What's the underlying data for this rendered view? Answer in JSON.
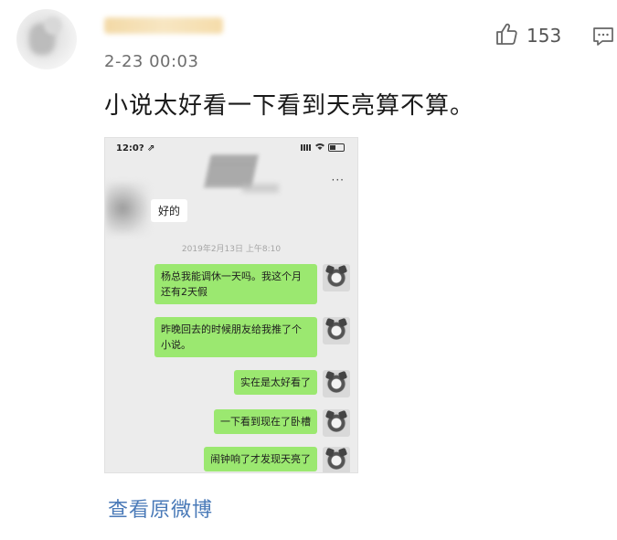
{
  "post": {
    "username": "",
    "timestamp": "2-23 00:03",
    "likes": "153",
    "text": "小说太好看一下看到天亮算不算。",
    "view_original": "查看原微博"
  },
  "screenshot": {
    "status_time": "12:0? ⇗",
    "more": "···",
    "received_message": "好的",
    "chat_time": "2019年2月13日 上午8:10",
    "sent_messages": [
      "杨总我能调休一天吗。我这个月还有2天假",
      "昨晚回去的时候朋友给我推了个小说。",
      "实在是太好看了",
      "一下看到现在了卧槽",
      "闹钟响了才发现天亮了"
    ]
  },
  "icons": {
    "like": "thumbs-up-icon",
    "comment": "comment-icon"
  },
  "colors": {
    "link": "#4a7ab8",
    "bubble_green": "#9be870"
  }
}
